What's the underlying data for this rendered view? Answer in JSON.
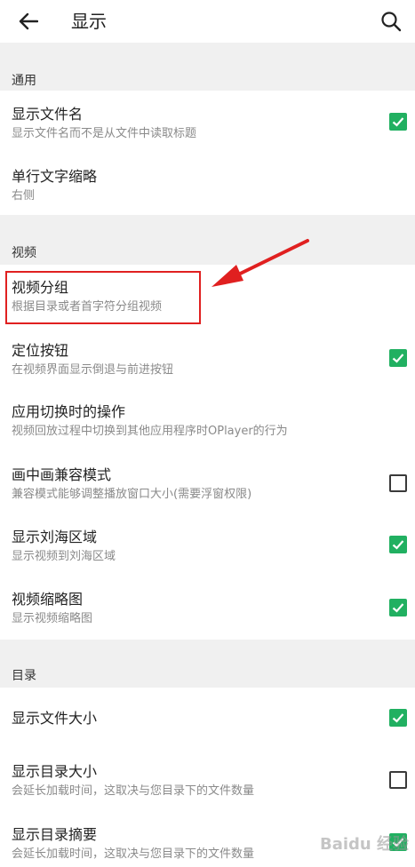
{
  "header": {
    "title": "显示",
    "back_icon": "arrow-left-icon",
    "search_icon": "search-icon"
  },
  "sections": [
    {
      "name": "通用",
      "items": [
        {
          "title": "显示文件名",
          "subtitle": "显示文件名而不是从文件中读取标题",
          "checkbox": true
        },
        {
          "title": "单行文字缩略",
          "subtitle": "右侧",
          "checkbox": null
        }
      ]
    },
    {
      "name": "视频",
      "items": [
        {
          "title": "视频分组",
          "subtitle": "根据目录或者首字符分组视频",
          "checkbox": null
        },
        {
          "title": "定位按钮",
          "subtitle": "在视频界面显示倒退与前进按钮",
          "checkbox": true
        },
        {
          "title": "应用切换时的操作",
          "subtitle": "视频回放过程中切换到其他应用程序时OPlayer的行为",
          "checkbox": null
        },
        {
          "title": "画中画兼容模式",
          "subtitle": "兼容模式能够调整播放窗口大小(需要浮窗权限)",
          "checkbox": false
        },
        {
          "title": "显示刘海区域",
          "subtitle": "显示视频到刘海区域",
          "checkbox": true
        },
        {
          "title": "视频缩略图",
          "subtitle": "显示视频缩略图",
          "checkbox": true
        }
      ]
    },
    {
      "name": "目录",
      "items": [
        {
          "title": "显示文件大小",
          "subtitle": "",
          "checkbox": true
        },
        {
          "title": "显示目录大小",
          "subtitle": "会延长加载时间，这取决与您目录下的文件数量",
          "checkbox": false
        },
        {
          "title": "显示目录摘要",
          "subtitle": "会延长加载时间，这取决与您目录下的文件数量",
          "checkbox": true
        }
      ]
    }
  ],
  "colors": {
    "accent": "#21b061",
    "annotation": "#e02020",
    "section_bg": "#f0f0f0"
  },
  "watermark": "Baidu 经验"
}
